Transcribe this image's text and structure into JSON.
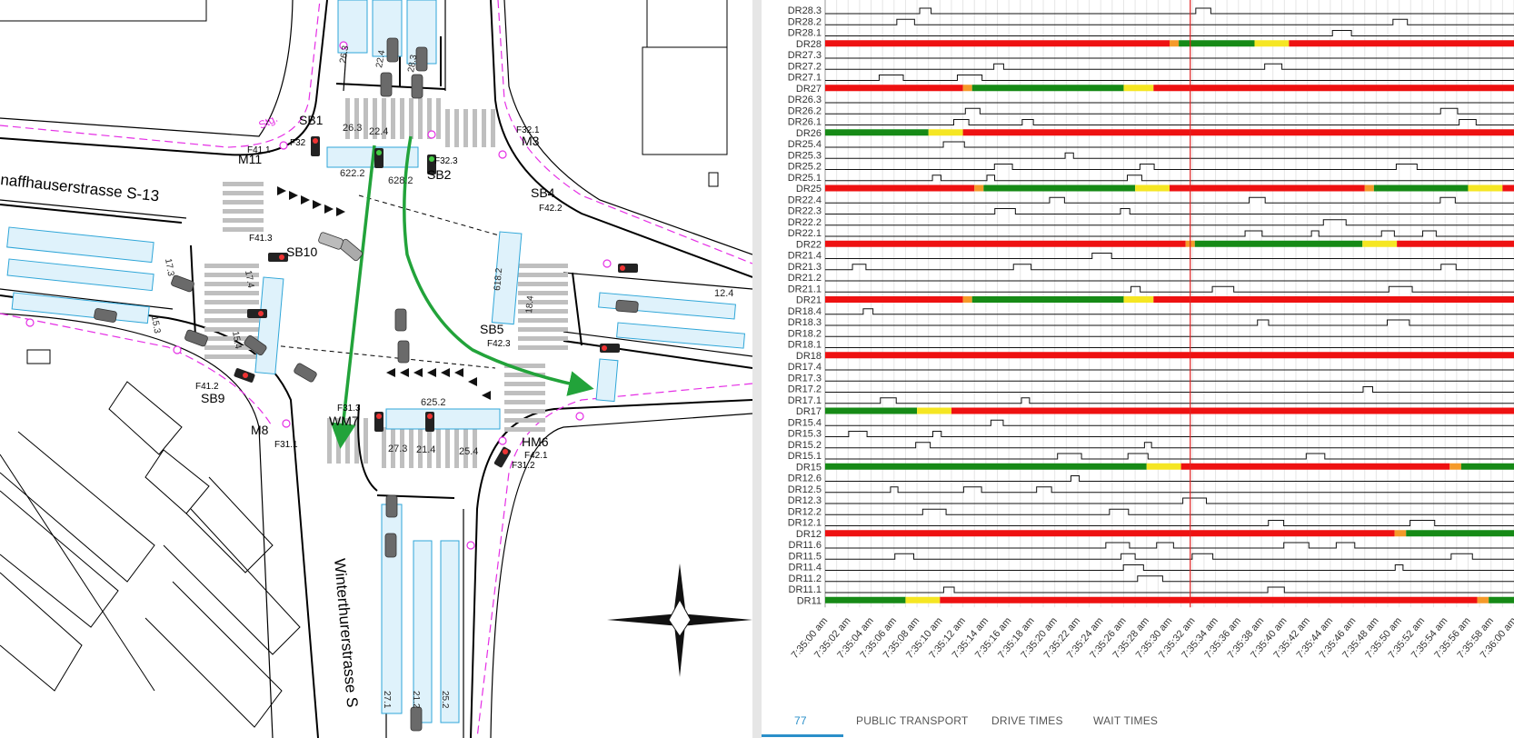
{
  "map": {
    "street_top_label": "naffhauserstrasse S-13",
    "street_bottom_label": "Winterthurerstrasse S",
    "stg_label": "Stg.",
    "signal_labels": [
      {
        "name": "signal-label-sb1",
        "text": "SB1"
      },
      {
        "name": "signal-label-m11",
        "text": "M11"
      },
      {
        "name": "signal-label-f41-1",
        "text": "F41.1"
      },
      {
        "name": "signal-label-f32",
        "text": "F32"
      },
      {
        "name": "signal-label-m3",
        "text": "M3"
      },
      {
        "name": "signal-label-f32-1",
        "text": "F32.1"
      },
      {
        "name": "signal-label-sb2",
        "text": "SB2"
      },
      {
        "name": "signal-label-f32-3",
        "text": "F32.3"
      },
      {
        "name": "signal-label-sb4",
        "text": "SB4"
      },
      {
        "name": "signal-label-f42-2",
        "text": "F42.2"
      },
      {
        "name": "signal-label-f41-3",
        "text": "F41.3"
      },
      {
        "name": "signal-label-sb10",
        "text": "SB10"
      },
      {
        "name": "signal-label-sb5",
        "text": "SB5"
      },
      {
        "name": "signal-label-f42-3",
        "text": "F42.3"
      },
      {
        "name": "signal-label-f41-2",
        "text": "F41.2"
      },
      {
        "name": "signal-label-sb9",
        "text": "SB9"
      },
      {
        "name": "signal-label-m8",
        "text": "M8"
      },
      {
        "name": "signal-label-f31-1",
        "text": "F31.1"
      },
      {
        "name": "signal-label-f31-3",
        "text": "F31.3"
      },
      {
        "name": "signal-label-wm7",
        "text": "WM7"
      },
      {
        "name": "signal-label-hm6",
        "text": "HM6"
      },
      {
        "name": "signal-label-f42-1",
        "text": "F42.1"
      },
      {
        "name": "signal-label-f31-2",
        "text": "F31.2"
      }
    ],
    "lane_labels": [
      {
        "name": "lane-label-26-3a",
        "text": "26.3"
      },
      {
        "name": "lane-label-22-4",
        "text": "22.4"
      },
      {
        "name": "lane-label-28-3",
        "text": "28.3"
      },
      {
        "name": "lane-label-26-3",
        "text": "26.3"
      },
      {
        "name": "lane-label-22-4b",
        "text": "22.4"
      },
      {
        "name": "lane-label-622-2",
        "text": "622.2"
      },
      {
        "name": "lane-label-628-2",
        "text": "628.2"
      },
      {
        "name": "lane-label-17-3",
        "text": "17.3"
      },
      {
        "name": "lane-label-15-3",
        "text": "15.3"
      },
      {
        "name": "lane-label-17-4",
        "text": "17.4"
      },
      {
        "name": "lane-label-15-4",
        "text": "15.4"
      },
      {
        "name": "lane-label-618-2",
        "text": "618.2"
      },
      {
        "name": "lane-label-18-4",
        "text": "18.4"
      },
      {
        "name": "lane-label-12-4",
        "text": "12.4"
      },
      {
        "name": "lane-label-625-2",
        "text": "625.2"
      },
      {
        "name": "lane-label-27-3",
        "text": "27.3"
      },
      {
        "name": "lane-label-21-4",
        "text": "21.4"
      },
      {
        "name": "lane-label-25-4",
        "text": "25.4"
      },
      {
        "name": "lane-label-27-1",
        "text": "27.1"
      },
      {
        "name": "lane-label-21-2",
        "text": "21.2"
      },
      {
        "name": "lane-label-25-2",
        "text": "25.2"
      }
    ]
  },
  "timeline": {
    "rows": [
      {
        "label": "DR28.3",
        "type": "det"
      },
      {
        "label": "DR28.2",
        "type": "det"
      },
      {
        "label": "DR28.1",
        "type": "det"
      },
      {
        "label": "DR28",
        "type": "sig",
        "segments": [
          [
            "r",
            0,
            15.0
          ],
          [
            "a",
            15.0,
            15.4
          ],
          [
            "g",
            15.4,
            18.7
          ],
          [
            "y",
            18.7,
            20.2
          ],
          [
            "r",
            20.2,
            30
          ]
        ]
      },
      {
        "label": "DR27.3",
        "type": "det"
      },
      {
        "label": "DR27.2",
        "type": "det"
      },
      {
        "label": "DR27.1",
        "type": "det"
      },
      {
        "label": "DR27",
        "type": "sig",
        "segments": [
          [
            "r",
            0,
            6.0
          ],
          [
            "a",
            6.0,
            6.4
          ],
          [
            "g",
            6.4,
            13.0
          ],
          [
            "y",
            13.0,
            14.3
          ],
          [
            "r",
            14.3,
            30
          ]
        ]
      },
      {
        "label": "DR26.3",
        "type": "det"
      },
      {
        "label": "DR26.2",
        "type": "det"
      },
      {
        "label": "DR26.1",
        "type": "det"
      },
      {
        "label": "DR26",
        "type": "sig",
        "segments": [
          [
            "g",
            0,
            4.5
          ],
          [
            "y",
            4.5,
            6.0
          ],
          [
            "r",
            6.0,
            30
          ]
        ]
      },
      {
        "label": "DR25.4",
        "type": "det"
      },
      {
        "label": "DR25.3",
        "type": "det"
      },
      {
        "label": "DR25.2",
        "type": "det"
      },
      {
        "label": "DR25.1",
        "type": "det"
      },
      {
        "label": "DR25",
        "type": "sig",
        "segments": [
          [
            "r",
            0,
            6.5
          ],
          [
            "a",
            6.5,
            6.9
          ],
          [
            "g",
            6.9,
            13.5
          ],
          [
            "y",
            13.5,
            15.0
          ],
          [
            "r",
            15.0,
            23.5
          ],
          [
            "a",
            23.5,
            23.9
          ],
          [
            "g",
            23.9,
            28.0
          ],
          [
            "y",
            28.0,
            29.5
          ],
          [
            "r",
            29.5,
            30
          ]
        ]
      },
      {
        "label": "DR22.4",
        "type": "det"
      },
      {
        "label": "DR22.3",
        "type": "det"
      },
      {
        "label": "DR22.2",
        "type": "det"
      },
      {
        "label": "DR22.1",
        "type": "det"
      },
      {
        "label": "DR22",
        "type": "sig",
        "segments": [
          [
            "r",
            0,
            15.7
          ],
          [
            "a",
            15.7,
            16.1
          ],
          [
            "g",
            16.1,
            23.4
          ],
          [
            "y",
            23.4,
            24.9
          ],
          [
            "r",
            24.9,
            30
          ]
        ]
      },
      {
        "label": "DR21.4",
        "type": "det"
      },
      {
        "label": "DR21.3",
        "type": "det"
      },
      {
        "label": "DR21.2",
        "type": "det"
      },
      {
        "label": "DR21.1",
        "type": "det"
      },
      {
        "label": "DR21",
        "type": "sig",
        "segments": [
          [
            "r",
            0,
            6.0
          ],
          [
            "a",
            6.0,
            6.4
          ],
          [
            "g",
            6.4,
            13.0
          ],
          [
            "y",
            13.0,
            14.3
          ],
          [
            "r",
            14.3,
            30
          ]
        ]
      },
      {
        "label": "DR18.4",
        "type": "det"
      },
      {
        "label": "DR18.3",
        "type": "det"
      },
      {
        "label": "DR18.2",
        "type": "det"
      },
      {
        "label": "DR18.1",
        "type": "det"
      },
      {
        "label": "DR18",
        "type": "sig",
        "segments": [
          [
            "r",
            0,
            30
          ]
        ]
      },
      {
        "label": "DR17.4",
        "type": "det"
      },
      {
        "label": "DR17.3",
        "type": "det"
      },
      {
        "label": "DR17.2",
        "type": "det"
      },
      {
        "label": "DR17.1",
        "type": "det"
      },
      {
        "label": "DR17",
        "type": "sig",
        "segments": [
          [
            "g",
            0,
            4.0
          ],
          [
            "y",
            4.0,
            5.5
          ],
          [
            "r",
            5.5,
            30
          ]
        ]
      },
      {
        "label": "DR15.4",
        "type": "det"
      },
      {
        "label": "DR15.3",
        "type": "det"
      },
      {
        "label": "DR15.2",
        "type": "det"
      },
      {
        "label": "DR15.1",
        "type": "det"
      },
      {
        "label": "DR15",
        "type": "sig",
        "segments": [
          [
            "g",
            0,
            14.0
          ],
          [
            "y",
            14.0,
            15.5
          ],
          [
            "r",
            15.5,
            27.2
          ],
          [
            "a",
            27.2,
            27.7
          ],
          [
            "g",
            27.7,
            30
          ]
        ]
      },
      {
        "label": "DR12.6",
        "type": "det"
      },
      {
        "label": "DR12.5",
        "type": "det"
      },
      {
        "label": "DR12.3",
        "type": "det"
      },
      {
        "label": "DR12.2",
        "type": "det"
      },
      {
        "label": "DR12.1",
        "type": "det"
      },
      {
        "label": "DR12",
        "type": "sig",
        "segments": [
          [
            "r",
            0,
            24.8
          ],
          [
            "a",
            24.8,
            25.3
          ],
          [
            "g",
            25.3,
            30
          ]
        ]
      },
      {
        "label": "DR11.6",
        "type": "det"
      },
      {
        "label": "DR11.5",
        "type": "det"
      },
      {
        "label": "DR11.4",
        "type": "det"
      },
      {
        "label": "DR11.2",
        "type": "det"
      },
      {
        "label": "DR11.1",
        "type": "det"
      },
      {
        "label": "DR11",
        "type": "sig",
        "segments": [
          [
            "g",
            0,
            3.5
          ],
          [
            "y",
            3.5,
            5.0
          ],
          [
            "r",
            5.0,
            28.4
          ],
          [
            "a",
            28.4,
            28.9
          ],
          [
            "g",
            28.9,
            30
          ]
        ]
      }
    ],
    "time_labels": [
      "7:35:00 am",
      "7:35:02 am",
      "7:35:04 am",
      "7:35:06 am",
      "7:35:08 am",
      "7:35:10 am",
      "7:35:12 am",
      "7:35:14 am",
      "7:35:16 am",
      "7:35:18 am",
      "7:35:20 am",
      "7:35:22 am",
      "7:35:24 am",
      "7:35:26 am",
      "7:35:28 am",
      "7:35:30 am",
      "7:35:32 am",
      "7:35:34 am",
      "7:35:36 am",
      "7:35:38 am",
      "7:35:40 am",
      "7:35:42 am",
      "7:35:44 am",
      "7:35:46 am",
      "7:35:48 am",
      "7:35:50 am",
      "7:35:52 am",
      "7:35:54 am",
      "7:35:56 am",
      "7:35:58 am",
      "7:36:00 am"
    ],
    "cursor_seconds": 15.9,
    "colors": {
      "red": "#ee1111",
      "green": "#168a16",
      "yellow": "#f5e623",
      "amber": "#f59a2a",
      "cursor": "#e02020"
    }
  },
  "tabs": [
    {
      "name": "tab-77",
      "label": "77",
      "active": true
    },
    {
      "name": "tab-public-transport",
      "label": "PUBLIC TRANSPORT",
      "active": false
    },
    {
      "name": "tab-drive-times",
      "label": "DRIVE TIMES",
      "active": false
    },
    {
      "name": "tab-wait-times",
      "label": "WAIT TIMES",
      "active": false
    }
  ]
}
